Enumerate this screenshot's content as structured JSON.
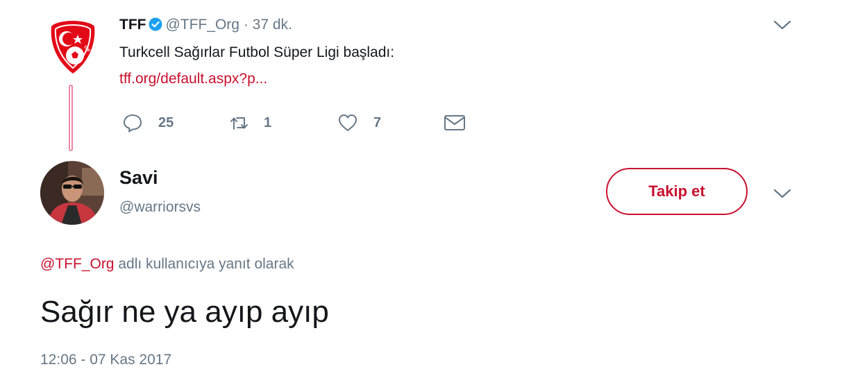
{
  "parent_tweet": {
    "name": "TFF",
    "handle": "@TFF_Org",
    "separator": "·",
    "time": "37 dk.",
    "text": "Turkcell Sağırlar Futbol Süper Ligi başladı:",
    "link": "tff.org/default.aspx?p...",
    "reply_count": "25",
    "retweet_count": "1",
    "like_count": "7",
    "avatar_icon": "tff-crest-logo",
    "verified_icon": "verified-badge-icon"
  },
  "reply_tweet": {
    "name": "Savi",
    "handle": "@warriorsvs",
    "follow_label": "Takip et",
    "replying_mention": "@TFF_Org",
    "replying_text": " adlı kullanıcıya yanıt olarak",
    "text": "Sağır ne ya ayıp ayıp",
    "timestamp": "12:06 - 07 Kas 2017"
  },
  "colors": {
    "accent": "#c8102e",
    "secondary_text": "#657786",
    "primary_text": "#14171a",
    "verified": "#1da1f2"
  }
}
